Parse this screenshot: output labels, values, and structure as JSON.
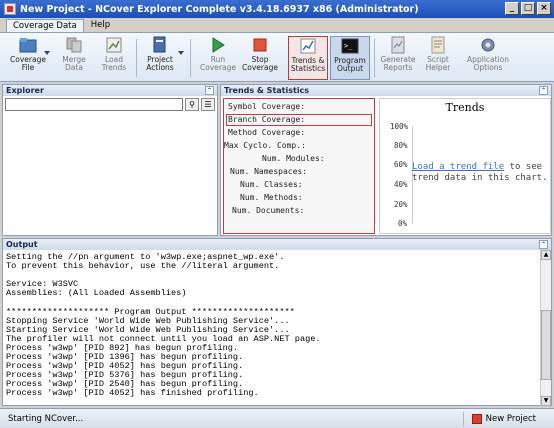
{
  "window": {
    "title": "New Project - NCover Explorer Complete v3.4.18.6937 x86 (Administrator)",
    "minimize": "_",
    "maximize": "□",
    "close": "×"
  },
  "ribbon_tabs": [
    {
      "label": "Coverage Data",
      "active": true
    },
    {
      "label": "Help",
      "active": false
    }
  ],
  "ribbon": {
    "coverage_file": "Coverage\nFile",
    "merge_data": "Merge\nData",
    "load_trends": "Load\nTrends",
    "project_actions": "Project\nActions",
    "run_coverage": "Run\nCoverage",
    "stop_coverage": "Stop\nCoverage",
    "trends_statistics": "Trends &\nStatistics",
    "program_output": "Program\nOutput",
    "generate_reports": "Generate\nReports",
    "script_helper": "Script\nHelper",
    "application_options": "Application\nOptions"
  },
  "explorer": {
    "title": "Explorer",
    "search_value": "",
    "search_icon": "search-icon",
    "options_icon": "options-icon"
  },
  "trends_panel": {
    "title": "Trends & Statistics",
    "stats": [
      "Symbol Coverage:",
      "Branch Coverage:",
      "Method Coverage:",
      "Max Cyclo. Comp.:",
      "Num. Modules:",
      "Num. Namespaces:",
      "Num. Classes:",
      "Num. Methods:",
      "Num. Documents:"
    ],
    "chart": {
      "title": "Trends",
      "y_ticks": [
        "100%",
        "80%",
        "60%",
        "40%",
        "20%",
        "0%"
      ],
      "link_text": "Load a trend file",
      "msg_text": " to see trend data in this chart."
    }
  },
  "chart_data": {
    "type": "line",
    "title": "Trends",
    "ylim": [
      0,
      100
    ],
    "y_ticks": [
      "100%",
      "80%",
      "60%",
      "40%",
      "20%",
      "0%"
    ],
    "series": []
  },
  "output": {
    "title": "Output",
    "lines": [
      "Setting the //pn argument to 'w3wp.exe;aspnet_wp.exe'.",
      "To prevent this behavior, use the //literal argument.",
      "",
      "Service: W3SVC",
      "Assemblies: (All Loaded Assemblies)",
      "",
      "******************** Program Output ********************",
      "Stopping Service 'World Wide Web Publishing Service'...",
      "Starting Service 'World Wide Web Publishing Service'...",
      "The profiler will not connect until you load an ASP.NET page.",
      "Process 'w3wp' [PID 892] has begun profiling.",
      "Process 'w3wp' [PID 1396] has begun profiling.",
      "Process 'w3wp' [PID 4052] has begun profiling.",
      "Process 'w3wp' [PID 5376] has begun profiling.",
      "Process 'w3wp' [PID 2540] has begun profiling.",
      "Process 'w3wp' [PID 4052] has finished profiling."
    ]
  },
  "status": {
    "left_text": "Starting NCover...",
    "new_project": "New Project"
  },
  "colors": {
    "titlebar": "#1b4fb8",
    "highlight_border": "#c83a3a",
    "link": "#3a6fd0"
  }
}
